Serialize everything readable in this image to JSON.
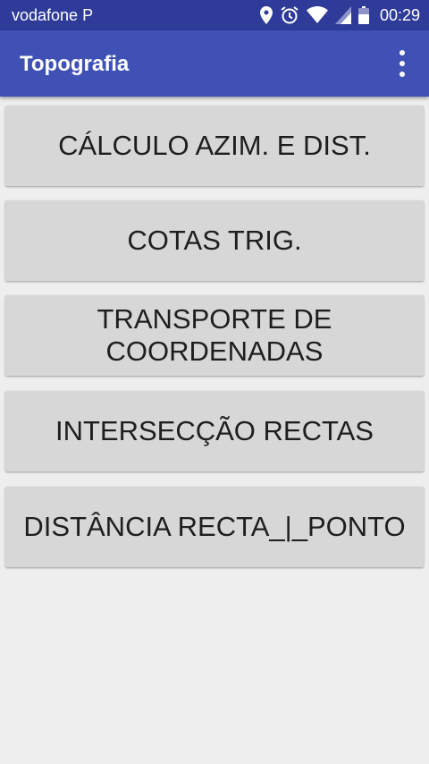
{
  "status_bar": {
    "carrier": "vodafone P",
    "time": "00:29",
    "icons": [
      "location-icon",
      "alarm-icon",
      "wifi-icon",
      "cell-signal-icon",
      "battery-icon"
    ]
  },
  "app_bar": {
    "title": "Topografia",
    "menu_icon": "more-vertical-icon",
    "color": "#3f51b5"
  },
  "menu": {
    "items": [
      {
        "label": "CÁLCULO AZIM. E DIST."
      },
      {
        "label": "COTAS TRIG."
      },
      {
        "label": "TRANSPORTE DE\nCOORDENADAS"
      },
      {
        "label": "INTERSECÇÃO RECTAS"
      },
      {
        "label": "DISTÂNCIA RECTA_|_PONTO"
      }
    ]
  },
  "colors": {
    "status_bar": "#2f3b99",
    "background": "#eeeeee",
    "button": "#d7d7d7"
  }
}
